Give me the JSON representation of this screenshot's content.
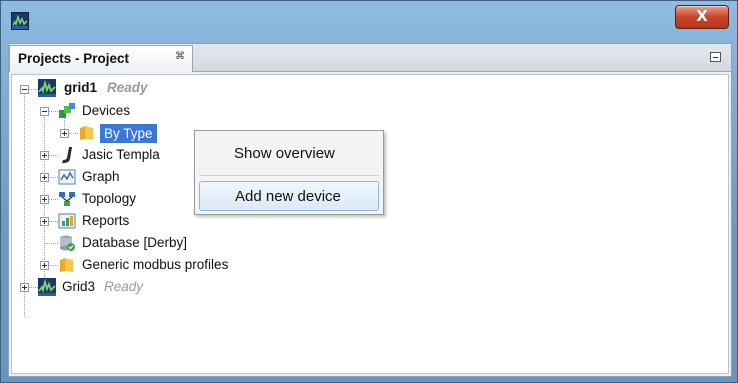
{
  "window": {
    "close_glyph": "X",
    "app_icon": "app-logo-icon"
  },
  "panel": {
    "tab_title": "Projects - Project",
    "tab_close_glyph": "⌘"
  },
  "tree": [
    {
      "name": "tree-item-grid1",
      "label": "grid1",
      "status": "Ready",
      "icon": "grid-project-icon"
    },
    {
      "name": "tree-item-devices",
      "label": "Devices",
      "icon": "devices-icon"
    },
    {
      "name": "tree-item-by-type",
      "label": "By Type",
      "icon": "folder-icon",
      "selected": true
    },
    {
      "name": "tree-item-jasic-templates",
      "label": "Jasic Templa",
      "icon": "jasic-icon"
    },
    {
      "name": "tree-item-graph",
      "label": "Graph",
      "icon": "graph-icon"
    },
    {
      "name": "tree-item-topology",
      "label": "Topology",
      "icon": "topology-icon"
    },
    {
      "name": "tree-item-reports",
      "label": "Reports",
      "icon": "reports-icon"
    },
    {
      "name": "tree-item-database",
      "label": "Database [Derby]",
      "icon": "database-icon"
    },
    {
      "name": "tree-item-generic-modbus",
      "label": "Generic modbus profiles",
      "icon": "folder-icon"
    },
    {
      "name": "tree-item-grid3",
      "label": "Grid3",
      "status": "Ready",
      "icon": "grid-project-icon"
    }
  ],
  "context_menu": {
    "items": [
      {
        "label": "Show overview"
      },
      {
        "label": "Add new device",
        "hover": true
      }
    ]
  },
  "colors": {
    "selection": "#3a78d6",
    "title_gradient": "#6a9ac4",
    "close_button": "#c8452a"
  }
}
